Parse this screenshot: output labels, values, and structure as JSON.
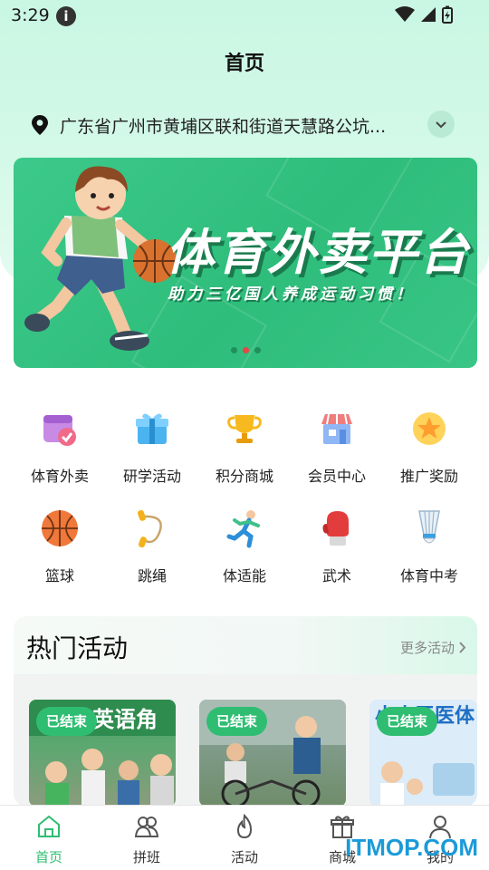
{
  "status": {
    "time": "3:29"
  },
  "page": {
    "title": "首页"
  },
  "location": {
    "text": "广东省广州市黄埔区联和街道天慧路公坑..."
  },
  "banner": {
    "title": "体育外卖平台",
    "subtitle": "助力三亿国人养成运动习惯！",
    "slide_count": 3,
    "active_slide": 2
  },
  "features": [
    {
      "label": "体育外卖",
      "icon": "calendar-icon"
    },
    {
      "label": "研学活动",
      "icon": "gift-icon"
    },
    {
      "label": "积分商城",
      "icon": "trophy-icon"
    },
    {
      "label": "会员中心",
      "icon": "store-icon"
    },
    {
      "label": "推广奖励",
      "icon": "star-icon"
    },
    {
      "label": "篮球",
      "icon": "basketball-icon"
    },
    {
      "label": "跳绳",
      "icon": "jump-rope-icon"
    },
    {
      "label": "体适能",
      "icon": "runner-icon"
    },
    {
      "label": "武术",
      "icon": "boxing-glove-icon"
    },
    {
      "label": "体育中考",
      "icon": "shuttlecock-icon"
    }
  ],
  "hot": {
    "title": "热门活动",
    "more_label": "更多活动",
    "cards": [
      {
        "status": "已结束",
        "image_text": "英语角"
      },
      {
        "status": "已结束",
        "image_text": ""
      },
      {
        "status": "已结束",
        "image_text": "小小牙医体"
      }
    ]
  },
  "tabs": [
    {
      "label": "首页",
      "icon": "home-icon",
      "active": true
    },
    {
      "label": "拼班",
      "icon": "group-icon",
      "active": false
    },
    {
      "label": "活动",
      "icon": "flame-icon",
      "active": false
    },
    {
      "label": "商城",
      "icon": "gift-box-icon",
      "active": false
    },
    {
      "label": "我的",
      "icon": "profile-icon",
      "active": false
    }
  ],
  "watermark": "ITMOP.COM",
  "colors": {
    "brand": "#2fbd72",
    "banner": "#3cc98a",
    "header_bg": "#c9f7e3"
  }
}
